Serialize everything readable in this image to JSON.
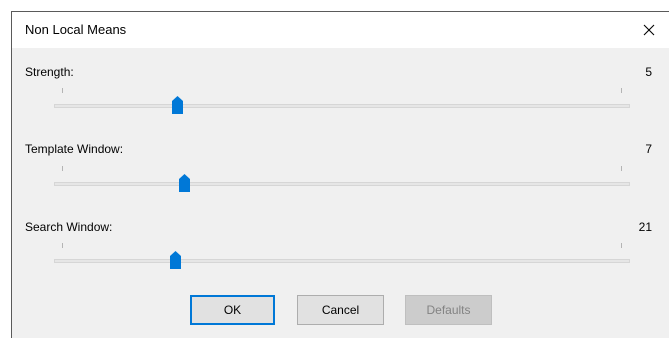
{
  "window": {
    "title": "Non Local Means",
    "close_icon": "close-icon"
  },
  "sliders": [
    {
      "label": "Strength:",
      "value": "5",
      "position_fraction": 0.213
    },
    {
      "label": "Template Window:",
      "value": "7",
      "position_fraction": 0.225
    },
    {
      "label": "Search Window:",
      "value": "21",
      "position_fraction": 0.21
    }
  ],
  "buttons": {
    "ok": "OK",
    "cancel": "Cancel",
    "defaults": "Defaults"
  },
  "colors": {
    "accent": "#0078d7",
    "dialog_bg": "#f0f0f0",
    "thumb": "#0078d7"
  }
}
